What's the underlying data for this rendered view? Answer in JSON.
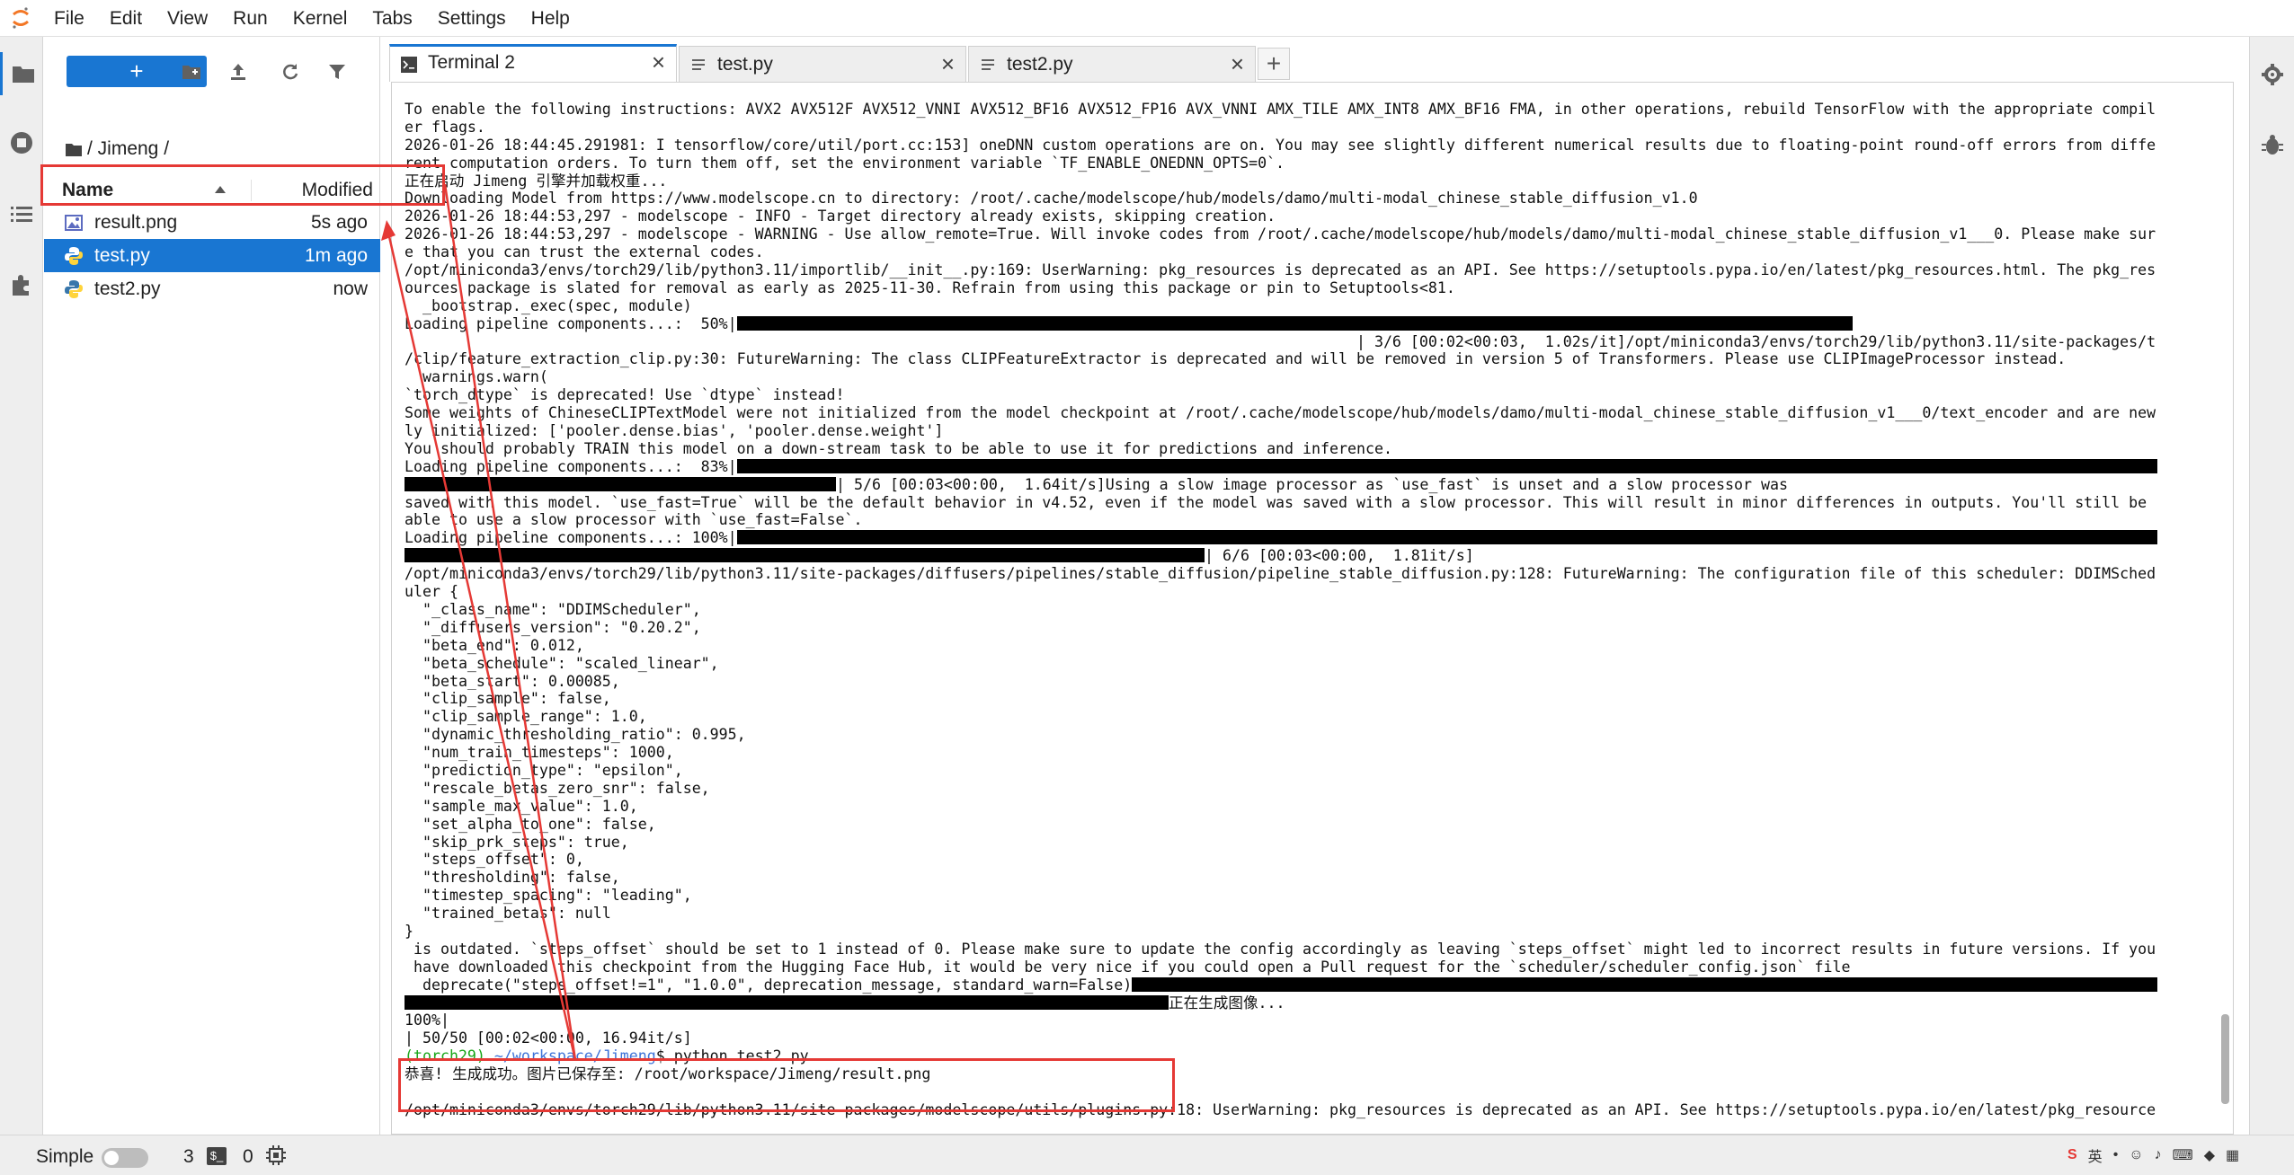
{
  "menubar": {
    "items": [
      "File",
      "Edit",
      "View",
      "Run",
      "Kernel",
      "Tabs",
      "Settings",
      "Help"
    ]
  },
  "file_browser": {
    "new_button_label": "+",
    "breadcrumb": "/ Jimeng /",
    "columns": {
      "name": "Name",
      "modified": "Modified"
    },
    "files": [
      {
        "name": "result.png",
        "modified": "5s ago",
        "icon": "image-icon"
      },
      {
        "name": "test.py",
        "modified": "1m ago",
        "icon": "python-icon"
      },
      {
        "name": "test2.py",
        "modified": "now",
        "icon": "python-icon"
      }
    ]
  },
  "tabs": [
    {
      "label": "Terminal 2",
      "icon": "terminal-icon"
    },
    {
      "label": "test.py",
      "icon": "text-file-icon"
    },
    {
      "label": "test2.py",
      "icon": "text-file-icon"
    }
  ],
  "terminal": {
    "lines": [
      "To enable the following instructions: AVX2 AVX512F AVX512_VNNI AVX512_BF16 AVX512_FP16 AVX_VNNI AMX_TILE AMX_INT8 AMX_BF16 FMA, in other operations, rebuild TensorFlow with the appropriate compil",
      "er flags.",
      "2026-01-26 18:44:45.291981: I tensorflow/core/util/port.cc:153] oneDNN custom operations are on. You may see slightly different numerical results due to floating-point round-off errors from diffe",
      "rent computation orders. To turn them off, set the environment variable `TF_ENABLE_ONEDNN_OPTS=0`.",
      "正在启动 Jimeng 引擎并加载权重...",
      "Downloading Model from https://www.modelscope.cn to directory: /root/.cache/modelscope/hub/models/damo/multi-modal_chinese_stable_diffusion_v1.0",
      "2026-01-26 18:44:53,297 - modelscope - INFO - Target directory already exists, skipping creation.",
      "2026-01-26 18:44:53,297 - modelscope - WARNING - Use allow_remote=True. Will invoke codes from /root/.cache/modelscope/hub/models/damo/multi-modal_chinese_stable_diffusion_v1___0. Please make sur",
      "e that you can trust the external codes.",
      "/opt/miniconda3/envs/torch29/lib/python3.11/importlib/__init__.py:169: UserWarning: pkg_resources is deprecated as an API. See https://setuptools.pypa.io/en/latest/pkg_resources.html. The pkg_res",
      "ources package is slated for removal as early as 2025-11-30. Refrain from using this package or pin to Setuptools<81.",
      "  _bootstrap._exec(spec, module)",
      "Loading pipeline components...:  50%|",
      "                                                                                                          | 3/6 [00:02<00:03,  1.02s/it]/opt/miniconda3/envs/torch29/lib/python3.11/site-packages/transformers/models",
      "/clip/feature_extraction_clip.py:30: FutureWarning: The class CLIPFeatureExtractor is deprecated and will be removed in version 5 of Transformers. Please use CLIPImageProcessor instead.",
      "  warnings.warn(",
      "`torch_dtype` is deprecated! Use `dtype` instead!",
      "Some weights of ChineseCLIPTextModel were not initialized from the model checkpoint at /root/.cache/modelscope/hub/models/damo/multi-modal_chinese_stable_diffusion_v1___0/text_encoder and are new",
      "ly initialized: ['pooler.dense.bias', 'pooler.dense.weight']",
      "You should probably TRAIN this model on a down-stream task to be able to use it for predictions and inference.",
      "Loading pipeline components...:  83%|",
      "| 5/6 [00:03<00:00,  1.64it/s]Using a slow image processor as `use_fast` is unset and a slow processor was",
      "saved with this model. `use_fast=True` will be the default behavior in v4.52, even if the model was saved with a slow processor. This will result in minor differences in outputs. You'll still be",
      "able to use a slow processor with `use_fast=False`.",
      "Loading pipeline components...: 100%|",
      "| 6/6 [00:03<00:00,  1.81it/s]",
      "/opt/miniconda3/envs/torch29/lib/python3.11/site-packages/diffusers/pipelines/stable_diffusion/pipeline_stable_diffusion.py:128: FutureWarning: The configuration file of this scheduler: DDIMSched",
      "uler {",
      "  \"_class_name\": \"DDIMScheduler\",",
      "  \"_diffusers_version\": \"0.20.2\",",
      "  \"beta_end\": 0.012,",
      "  \"beta_schedule\": \"scaled_linear\",",
      "  \"beta_start\": 0.00085,",
      "  \"clip_sample\": false,",
      "  \"clip_sample_range\": 1.0,",
      "  \"dynamic_thresholding_ratio\": 0.995,",
      "  \"num_train_timesteps\": 1000,",
      "  \"prediction_type\": \"epsilon\",",
      "  \"rescale_betas_zero_snr\": false,",
      "  \"sample_max_value\": 1.0,",
      "  \"set_alpha_to_one\": false,",
      "  \"skip_prk_steps\": true,",
      "  \"steps_offset\": 0,",
      "  \"thresholding\": false,",
      "  \"timestep_spacing\": \"leading\",",
      "  \"trained_betas\": null",
      "}",
      " is outdated. `steps_offset` should be set to 1 instead of 0. Please make sure to update the config accordingly as leaving `steps_offset` might led to incorrect results in future versions. If you",
      " have downloaded this checkpoint from the Hugging Face Hub, it would be very nice if you could open a Pull request for the `scheduler/scheduler_config.json` file",
      "  deprecate(\"steps_offset!=1\", \"1.0.0\", deprecation_message, standard_warn=False)",
      "正在生成图像...",
      "100%|",
      "| 50/50 [00:02<00:00, 16.94it/s]",
      "",
      "恭喜! 生成成功。图片已保存至: /root/workspace/Jimeng/result.png",
      "",
      "/opt/miniconda3/envs/torch29/lib/python3.11/site-packages/modelscope/utils/plugins.py:18: UserWarning: pkg_resources is deprecated as an API. See https://setuptools.pypa.io/en/latest/pkg_resource"
    ],
    "prompt": {
      "env": "(torch29)",
      "path": "~/workspace/Jimeng",
      "command": "$ python test2.py"
    },
    "progress": [
      {
        "label": "Loading pipeline components 3/6",
        "fraction": 0.5
      },
      {
        "label": "Loading pipeline components 5/6",
        "fraction": 0.83
      },
      {
        "label": "Loading pipeline components 6/6",
        "fraction": 1.0
      },
      {
        "label": "Generating 50/50",
        "fraction": 1.0
      }
    ]
  },
  "statusbar": {
    "mode_label": "Simple",
    "terminals_count": "3",
    "terminal_icon_label": "$_",
    "kernels_count": "0",
    "ime_label": "英"
  },
  "colors": {
    "accent": "#1976d2",
    "annotation": "#e53935",
    "prompt_env": "#19a619",
    "prompt_path": "#3d73d8"
  }
}
